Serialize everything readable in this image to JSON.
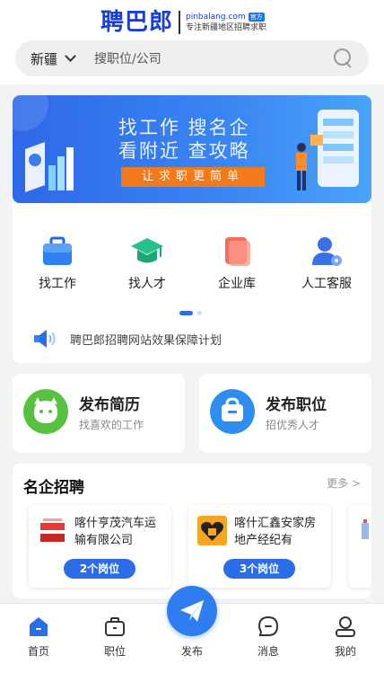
{
  "header": {
    "logo_text": "聘巴郎",
    "domain": "pinbalang.com",
    "official_badge": "官方",
    "slogan": "专注新疆地区招聘求职"
  },
  "search": {
    "city": "新疆",
    "placeholder": "搜职位/公司"
  },
  "banner": {
    "line1": "找工作  搜名企",
    "line2": "看附近  查攻略",
    "button": "让求职更简单"
  },
  "quick_nav": [
    {
      "label": "找工作",
      "icon": "briefcase-icon"
    },
    {
      "label": "找人才",
      "icon": "graduation-cap-icon"
    },
    {
      "label": "企业库",
      "icon": "company-folder-icon"
    },
    {
      "label": "人工客服",
      "icon": "customer-service-icon"
    }
  ],
  "notice": {
    "text": "聘巴郎招聘网站效果保障计划"
  },
  "publish_cards": {
    "resume": {
      "title": "发布简历",
      "subtitle": "找喜欢的工作"
    },
    "job": {
      "title": "发布职位",
      "subtitle": "招优秀人才"
    }
  },
  "famous": {
    "title": "名企招聘",
    "more": "更多 >",
    "companies": [
      {
        "name": "喀什亨茂汽车运输有限公司",
        "positions": "2个岗位"
      },
      {
        "name": "喀什汇鑫安家房地产经纪有",
        "positions": "3个岗位"
      }
    ]
  },
  "tabbar": {
    "home": "首页",
    "jobs": "职位",
    "publish": "发布",
    "messages": "消息",
    "mine": "我的"
  },
  "colors": {
    "brand_blue": "#1a3fd6",
    "accent_blue": "#2b6de6",
    "banner_orange": "#f07a1c"
  }
}
